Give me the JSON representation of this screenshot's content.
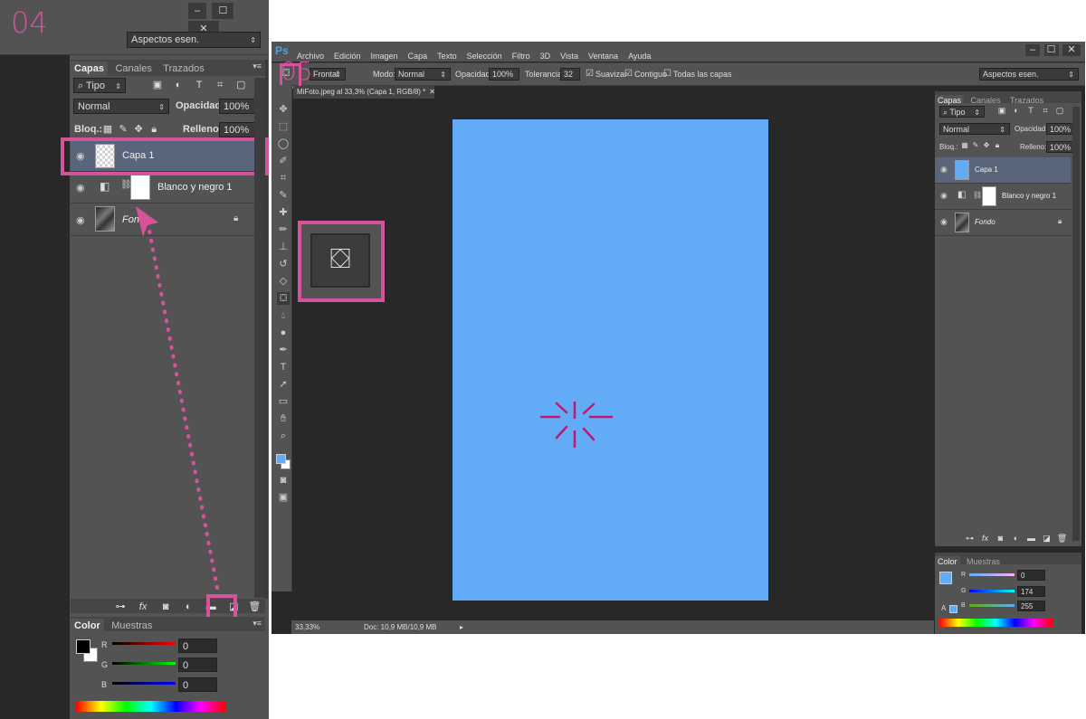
{
  "step_a": {
    "label": "04"
  },
  "step_b": {
    "label": "05"
  },
  "left": {
    "workspace": "Aspectos esen.",
    "layers_tabs": [
      "Capas",
      "Canales",
      "Trazados"
    ],
    "filter_kind": "Tipo",
    "blend_mode": "Normal",
    "opacity_label": "Opacidad:",
    "opacity_value": "100%",
    "lock_label": "Bloq.:",
    "fill_label": "Relleno:",
    "fill_value": "100%",
    "layers": [
      {
        "name": "Capa 1"
      },
      {
        "name": "Blanco y negro 1"
      },
      {
        "name": "Fondo"
      }
    ],
    "color_tabs": [
      "Color",
      "Muestras"
    ],
    "channels": [
      {
        "label": "R",
        "value": "0"
      },
      {
        "label": "G",
        "value": "0"
      },
      {
        "label": "B",
        "value": "0"
      }
    ],
    "fg_color": "#000000",
    "bg_color": "#ffffff"
  },
  "ps": {
    "logo": "Ps",
    "menu": [
      "Archivo",
      "Edición",
      "Imagen",
      "Capa",
      "Texto",
      "Selección",
      "Filtro",
      "3D",
      "Vista",
      "Ventana",
      "Ayuda"
    ],
    "options": {
      "source": "Frontal",
      "mode_label": "Modo:",
      "mode_value": "Normal",
      "opacity_label": "Opacidad:",
      "opacity_value": "100%",
      "tolerance_label": "Tolerancia:",
      "tolerance_value": "32",
      "smooth_label": "Suavizar",
      "contiguous_label": "Contiguo",
      "all_layers_label": "Todas las capas",
      "workspace": "Aspectos esen."
    },
    "doc_tab": "MiFoto.jpeg al 33,3% (Capa 1, RGB/8) *",
    "canvas_color": "#62acf7",
    "zoom": "33,33%",
    "doc_info": "Doc: 10,9 MB/10,9 MB",
    "right": {
      "layers_tabs": [
        "Capas",
        "Canales",
        "Trazados"
      ],
      "filter_kind": "Tipo",
      "blend_mode": "Normal",
      "opacity_label": "Opacidad:",
      "opacity_value": "100%",
      "lock_label": "Bloq.:",
      "fill_label": "Relleno:",
      "fill_value": "100%",
      "layers": [
        {
          "name": "Capa 1"
        },
        {
          "name": "Blanco y negro 1"
        },
        {
          "name": "Fondo"
        }
      ],
      "color_tabs": [
        "Color",
        "Muestras"
      ],
      "channels": [
        {
          "label": "R",
          "value": "0"
        },
        {
          "label": "G",
          "value": "174"
        },
        {
          "label": "B",
          "value": "255"
        }
      ],
      "fg_color": "#62acf7"
    }
  },
  "colors": {
    "highlight": "#d4539b",
    "panel": "#535353",
    "dark": "#282828"
  }
}
